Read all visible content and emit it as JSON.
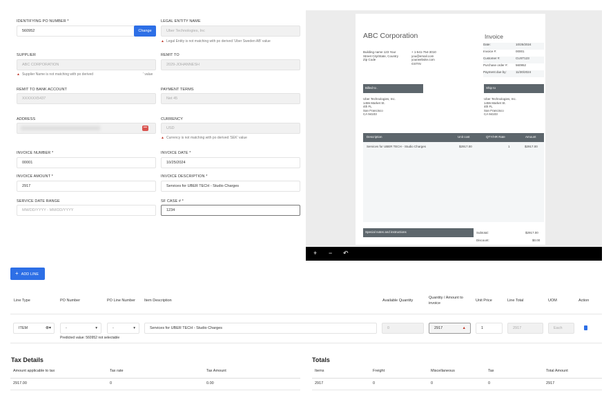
{
  "form": {
    "po_number": {
      "label": "IDENTIFYING PO NUMBER *",
      "value": "560952",
      "button": "Change"
    },
    "legal_entity": {
      "label": "LEGAL ENTITY NAME",
      "value": "Uber Technologies, Inc",
      "warning": "Legal Entity is not matching with po derived 'Uber Sweden AB' value"
    },
    "supplier": {
      "label": "SUPPLIER",
      "value": "ABC CORPORATION",
      "warning": "Supplier Name is not matching with po derived",
      "warning_tail": "' value"
    },
    "remit_to": {
      "label": "REMIT TO",
      "value": "2029-JOHANNESH"
    },
    "bank_account": {
      "label": "REMIT TO BANK ACCOUNT",
      "value": "XXXXXX5437"
    },
    "payment_terms": {
      "label": "PAYMENT TERMS",
      "value": "Net 45"
    },
    "address": {
      "label": "ADDRESS",
      "value": ""
    },
    "currency": {
      "label": "CURRENCY",
      "value": "USD",
      "warning": "Currency is not matching with po derived 'SEK' value"
    },
    "invoice_number": {
      "label": "INVOICE NUMBER *",
      "value": "00001"
    },
    "invoice_date": {
      "label": "INVOICE DATE *",
      "value": "10/25/2024"
    },
    "invoice_amount": {
      "label": "INVOICE AMOUNT *",
      "value": "2917"
    },
    "invoice_description": {
      "label": "INVOICE DESCRIPTION *",
      "value": "Services for UBER TECH - Studio Charges"
    },
    "service_date_range": {
      "label": "SERVICE DATE RANGE",
      "placeholder": "MM/DD/YYYY - MM/DD/YYYY"
    },
    "sf_case": {
      "label": "SF CASE # *",
      "value": "1234"
    }
  },
  "preview": {
    "company": "ABC Corporation",
    "address_lines": [
      "Building name 123 Your",
      "Street City/State, Country",
      "Zip Code"
    ],
    "contact_lines": [
      "+ 1-541-754-3010",
      "you@email.com",
      "yourwebsite.com",
      "GSTIN"
    ],
    "title": "Invoice",
    "meta": [
      {
        "k": "Date:",
        "v": "10/25/2024"
      },
      {
        "k": "Invoice #:",
        "v": "00001"
      },
      {
        "k": "Customer #:",
        "v": "CUST123"
      },
      {
        "k": "Purchase order #:",
        "v": "560952"
      },
      {
        "k": "Payment due by:",
        "v": "11/30/2024"
      }
    ],
    "billed_to": "Billed to .",
    "ship_to": "Ship to",
    "billed_lines": [
      "Uber Technologies, Inc.",
      "1455 Market St.",
      "4th FL",
      "San Francisco",
      "CA 94103"
    ],
    "ship_lines": [
      "Uber Technologies, Inc.",
      "1455 Market St.",
      "4th FL",
      "San Francisco",
      "CA 94103"
    ],
    "table_headers": [
      "Description",
      "Unit cost",
      "QTY/HR Rate",
      "Amount"
    ],
    "row": [
      "Services for UBER TECH - Studio Charges",
      "$2917.00",
      "1",
      "$2917.00"
    ],
    "notes": "Special notes and instructions",
    "subtotal_label": "Subtotal:",
    "subtotal": "$2917.00",
    "discount_label": "Discount:",
    "discount": "$0.00",
    "toolbar": {
      "zoom_in": "+",
      "zoom_out": "−",
      "rotate": "↶"
    }
  },
  "lines": {
    "add_label": "ADD LINE",
    "headers": [
      "Line Type",
      "PO Number",
      "PO Line Number",
      "Item Description",
      "Available Quantity",
      "Quantity / Amount to invoice",
      "Unit Price",
      "Line Total",
      "UOM",
      "Action"
    ],
    "row": {
      "line_type": "ITEM",
      "po_number": "-",
      "po_line": "-",
      "description": "Services for UBER TECH - Studio Charges",
      "available": "0",
      "quantity": "2917",
      "unit_price": "1",
      "line_total": "2917",
      "uom": "Each",
      "hint": "Predicted value: 560952 not selectable"
    }
  },
  "tax": {
    "title": "Tax Details",
    "headers": [
      "Amount applicable to tax",
      "Tax rate",
      "Tax Amount"
    ],
    "values": [
      "2917.00",
      "0",
      "0.00"
    ]
  },
  "totals": {
    "title": "Totals",
    "headers": [
      "Items",
      "Freight",
      "Miscellaneous",
      "Tax",
      "Total Amount"
    ],
    "values": [
      "2917",
      "0",
      "0",
      "0",
      "2917"
    ]
  },
  "colors": {
    "primary": "#2d6fe6",
    "warning": "#c0392b",
    "header_bar": "#5d666c"
  }
}
